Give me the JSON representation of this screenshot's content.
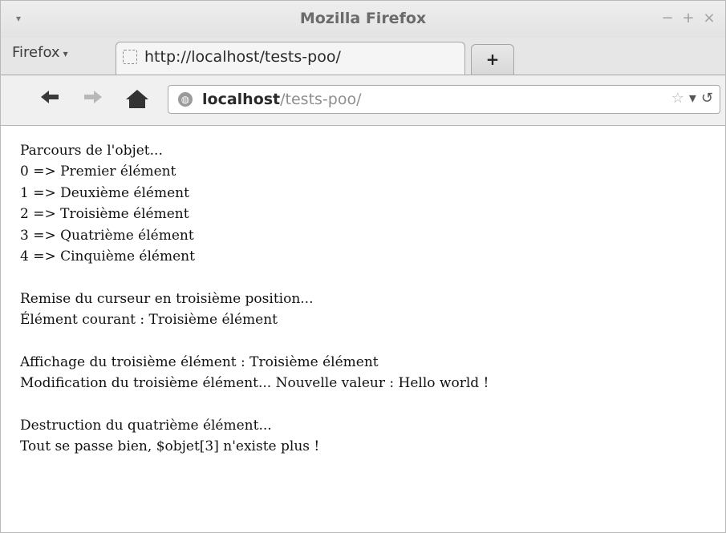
{
  "window": {
    "title": "Mozilla Firefox",
    "menu_arrow": "▾",
    "buttons": {
      "minimize": "−",
      "maximize": "+",
      "close": "×"
    }
  },
  "tabbar": {
    "firefox_menu": "Firefox",
    "firefox_menu_caret": "▾",
    "active_tab_title": "http://localhost/tests-poo/",
    "new_tab_symbol": "+"
  },
  "navbar": {
    "back_icon": "back-arrow-icon",
    "forward_icon": "forward-arrow-icon",
    "home_icon": "home-icon",
    "url_host": "localhost",
    "url_path": "/tests-poo/",
    "bookmark_icon": "☆",
    "dropdown_icon": "▾",
    "reload_icon": "↺"
  },
  "content": {
    "lines": [
      "Parcours de l'objet...",
      "0 => Premier élément",
      "1 => Deuxième élément",
      "2 => Troisième élément",
      "3 => Quatrième élément",
      "4 => Cinquième élément",
      "",
      "Remise du curseur en troisième position...",
      "Élément courant : Troisième élément",
      "",
      "Affichage du troisième élément : Troisième élément",
      "Modification du troisième élément... Nouvelle valeur : Hello world !",
      "",
      "Destruction du quatrième élément...",
      "Tout se passe bien, $objet[3] n'existe plus !"
    ]
  }
}
